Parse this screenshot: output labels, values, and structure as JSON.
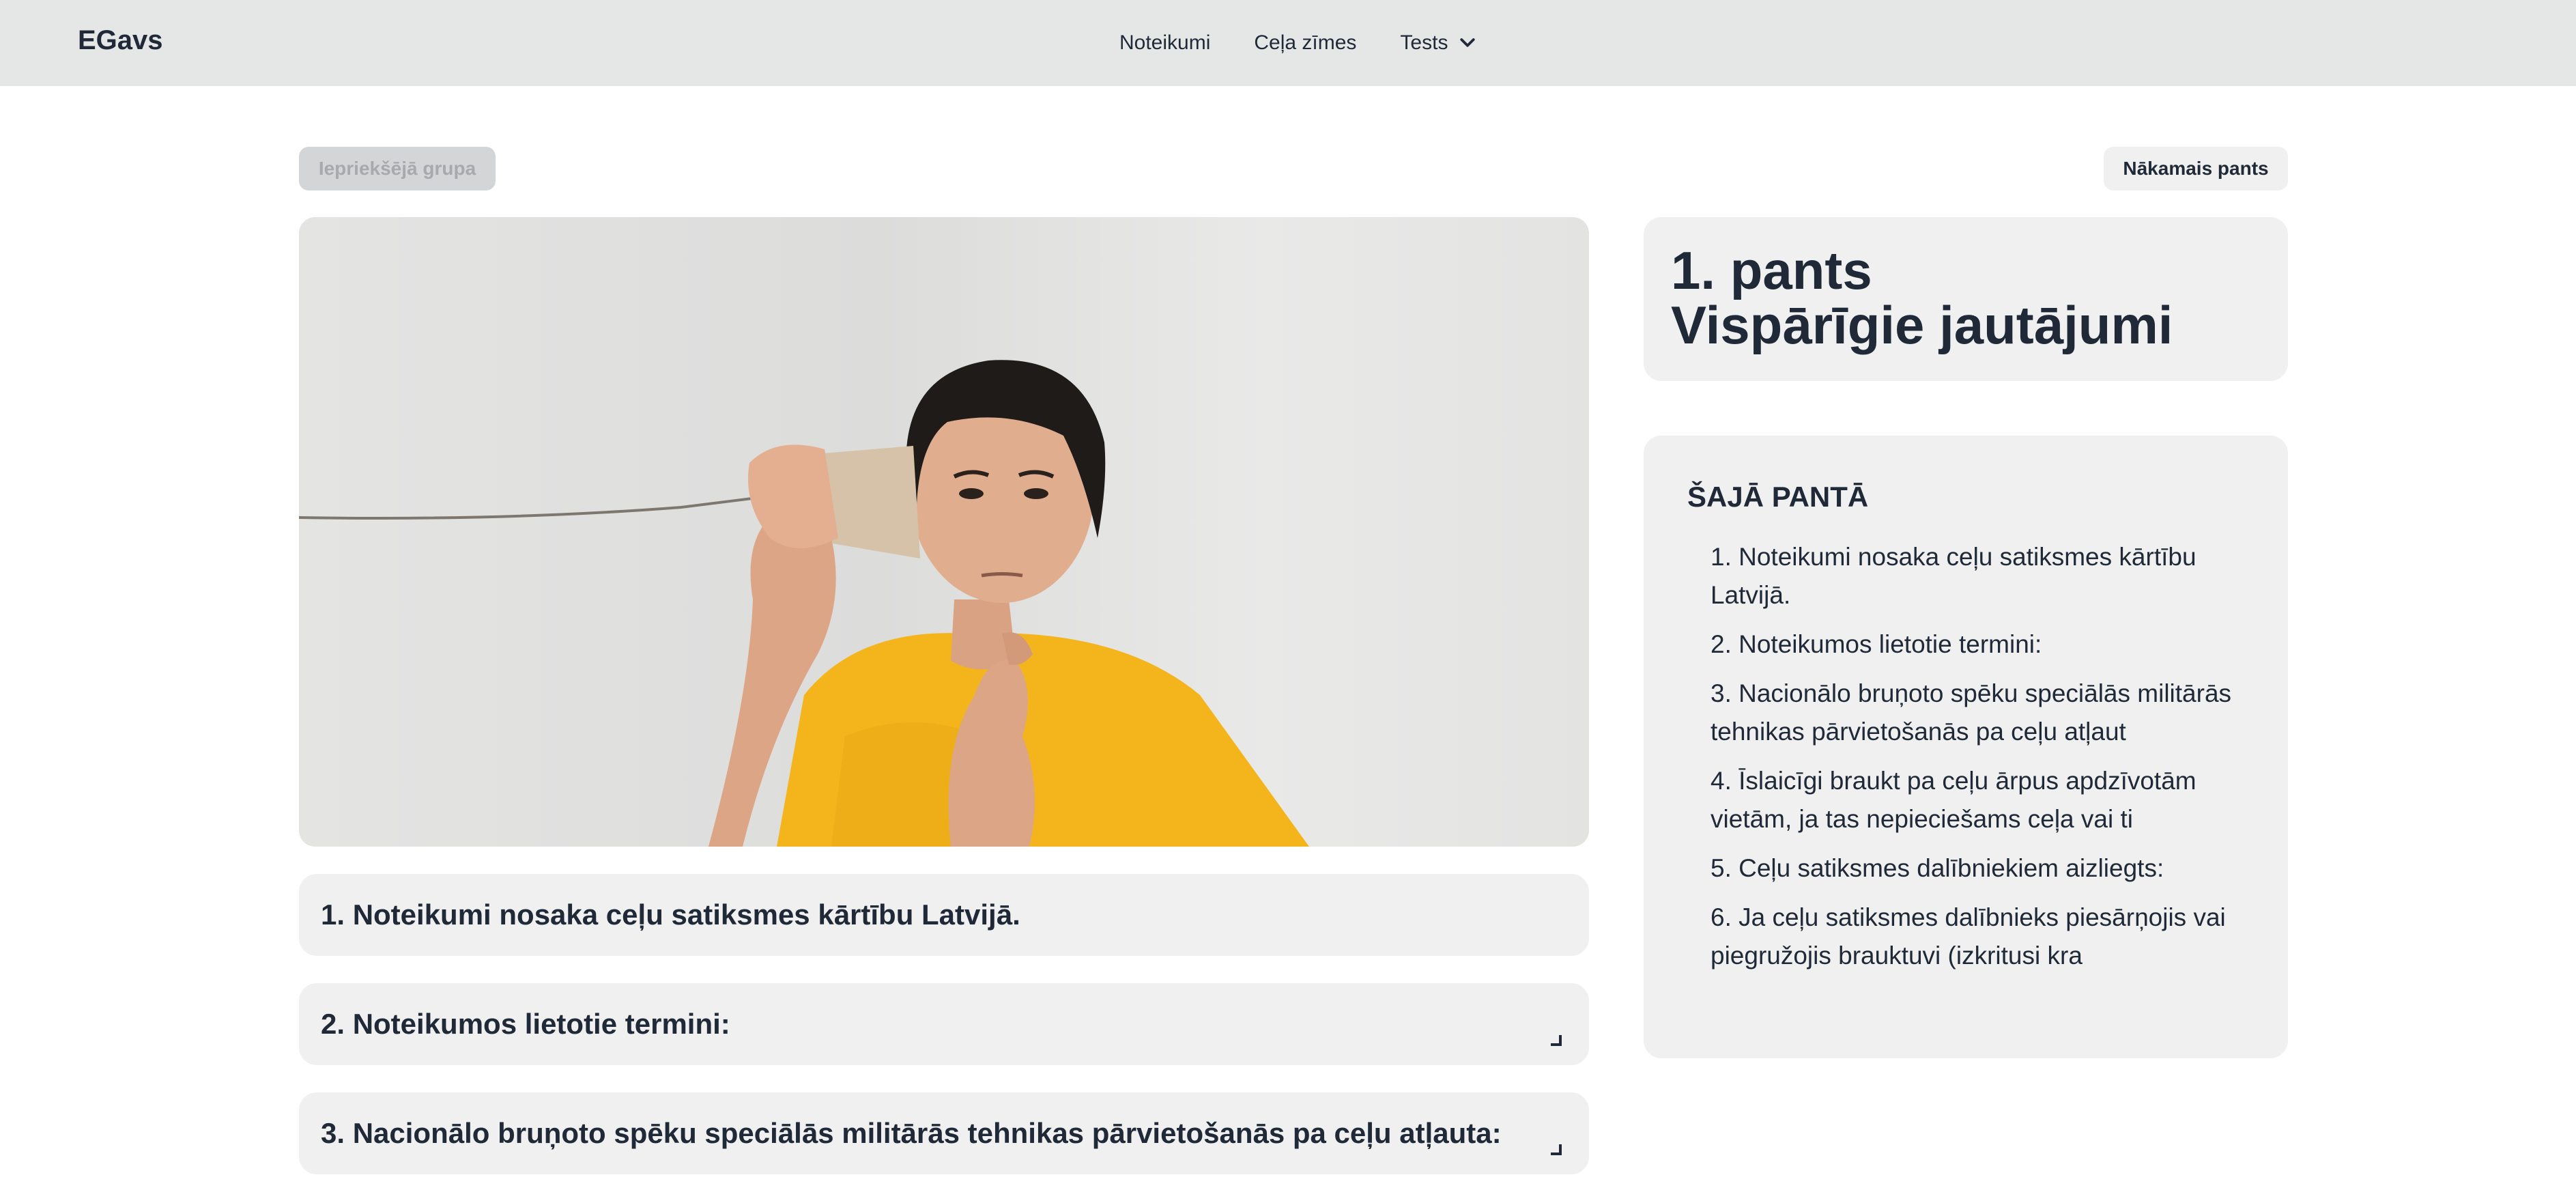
{
  "header": {
    "brand": "EGavs",
    "nav": [
      {
        "label": "Noteikumi"
      },
      {
        "label": "Ceļa zīmes"
      },
      {
        "label": "Tests",
        "icon": "chevron-down-icon"
      }
    ]
  },
  "pager": {
    "prev_label": "Iepriekšējā grupa",
    "next_label": "Nākamais pants"
  },
  "article": {
    "number_line": "1. pants",
    "title_line": "Vispārīgie jautājumi"
  },
  "sections": [
    {
      "label": "1. Noteikumi nosaka ceļu satiksmes kārtību Latvijā."
    },
    {
      "label": "2. Noteikumos lietotie termini:"
    },
    {
      "label": "3.  Nacionālo bruņoto spēku speciālās militārās tehnikas pārvietošanās pa ceļu atļauta:"
    }
  ],
  "toc": {
    "heading": "ŠAJĀ PANTĀ",
    "items": [
      "1. Noteikumi nosaka ceļu satiksmes kārtību Latvijā.",
      "2. Noteikumos lietotie termini:",
      "3.  Nacionālo bruņoto spēku speciālās militārās tehnikas pārvietošanās pa ceļu atļaut",
      "4. Īslaicīgi braukt pa ceļu ārpus apdzīvotām vietām, ja tas nepieciešams ceļa vai ti",
      "5. Ceļu satiksmes dalībniekiem aizliegts:",
      "6. Ja ceļu satiksmes dalībnieks piesārņojis vai piegružojis brauktuvi (izkritusi kra"
    ]
  },
  "colors": {
    "header_bg": "#e5e6e6",
    "card_bg": "#f0f0f0",
    "text": "#1f2937",
    "disabled_bg": "#d4d5d7",
    "disabled_text": "#a7a9ad",
    "shirt": "#f3b51b"
  }
}
